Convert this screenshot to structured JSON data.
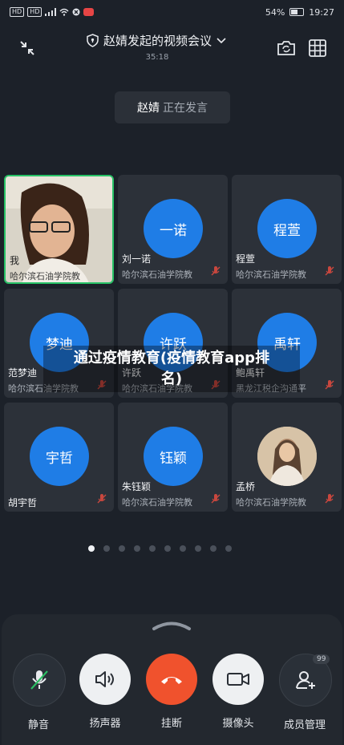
{
  "status_bar": {
    "left_badges": [
      "HD",
      "HD"
    ],
    "battery": "54%",
    "time": "19:27"
  },
  "header": {
    "title": "赵婧发起的视频会议",
    "duration": "35:18",
    "icons": {
      "collapse": "collapse-icon",
      "shield": "shield-icon",
      "chevron": "chevron-down-icon",
      "switch_camera": "switch-camera-icon",
      "grid": "grid-view-icon"
    }
  },
  "speaking_indicator": {
    "name": "赵婧",
    "status": "正在发言"
  },
  "participants": [
    {
      "avatar_text": "",
      "name": "我",
      "org": "哈尔滨石油学院教",
      "muted": false,
      "photo": true,
      "active": true
    },
    {
      "avatar_text": "一诺",
      "name": "刘一诺",
      "org": "哈尔滨石油学院教",
      "muted": true
    },
    {
      "avatar_text": "程萱",
      "name": "程萱",
      "org": "哈尔滨石油学院教",
      "muted": true
    },
    {
      "avatar_text": "梦迪",
      "name": "范梦迪",
      "org": "哈尔滨石油学院教",
      "muted": true
    },
    {
      "avatar_text": "许跃",
      "name": "许跃",
      "org": "哈尔滨石油学院教",
      "muted": true
    },
    {
      "avatar_text": "禹轩",
      "name": "鲍禹轩",
      "org": "黑龙江税企沟通平",
      "muted": true
    },
    {
      "avatar_text": "宇哲",
      "name": "胡宇哲",
      "org": "",
      "muted": true
    },
    {
      "avatar_text": "钰颖",
      "name": "朱钰颖",
      "org": "哈尔滨石油学院教",
      "muted": true
    },
    {
      "avatar_text": "",
      "name": "孟桥",
      "org": "哈尔滨石油学院教",
      "muted": true,
      "photo": true
    }
  ],
  "overlay_caption": {
    "line1": "通过疫情教育(疫情教育app排",
    "line2": "名)"
  },
  "pager": {
    "count": 10,
    "active_index": 0
  },
  "controls": [
    {
      "label": "静音",
      "icon": "mic-muted-icon",
      "color": "#2a3038"
    },
    {
      "label": "扬声器",
      "icon": "speaker-icon",
      "color": "#eef0f2"
    },
    {
      "label": "挂断",
      "icon": "hang-up-icon",
      "color": "#f0522d"
    },
    {
      "label": "摄像头",
      "icon": "camera-icon",
      "color": "#eef0f2"
    },
    {
      "label": "成员管理",
      "icon": "members-icon",
      "color": "#2a3038"
    }
  ],
  "member_count": "99"
}
